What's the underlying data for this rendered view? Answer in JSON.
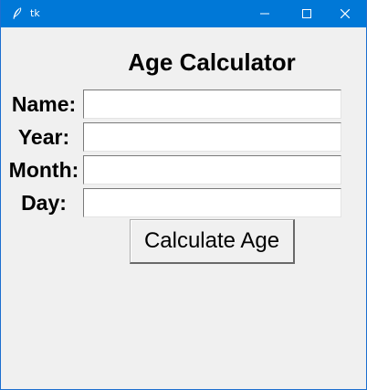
{
  "window": {
    "title": "tk",
    "controls": {
      "minimize_icon": "minimize-icon",
      "maximize_icon": "maximize-icon",
      "close_icon": "close-icon"
    },
    "titlebar_color": "#0078d7"
  },
  "form": {
    "heading": "Age Calculator",
    "fields": [
      {
        "label": "Name:",
        "value": ""
      },
      {
        "label": "Year:",
        "value": ""
      },
      {
        "label": "Month:",
        "value": ""
      },
      {
        "label": "Day:",
        "value": ""
      }
    ],
    "submit_label": "Calculate Age"
  }
}
